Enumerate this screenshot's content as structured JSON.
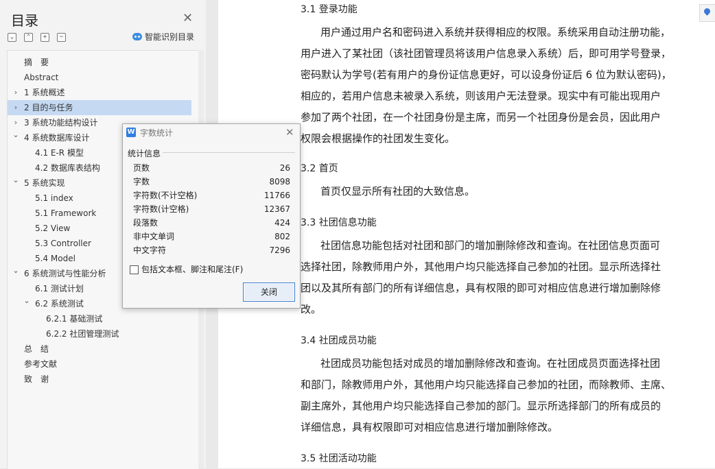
{
  "toc": {
    "title": "目录",
    "smart_label": "智能识别目录",
    "toolbar_icons": [
      "collapse-all-icon",
      "expand-all-icon",
      "plus-icon",
      "minus-icon"
    ],
    "items": [
      {
        "label": "摘　要",
        "level": 0,
        "chevron": ""
      },
      {
        "label": "Abstract",
        "level": 0,
        "chevron": ""
      },
      {
        "label": "1  系统概述",
        "level": 0,
        "chevron": "right"
      },
      {
        "label": "2  目的与任务",
        "level": 0,
        "chevron": "right",
        "selected": true
      },
      {
        "label": "3  系统功能结构设计",
        "level": 0,
        "chevron": "right"
      },
      {
        "label": "4  系统数据库设计",
        "level": 0,
        "chevron": "down"
      },
      {
        "label": "4.1 E-R 模型",
        "level": 1,
        "chevron": ""
      },
      {
        "label": "4.2  数据库表结构",
        "level": 1,
        "chevron": ""
      },
      {
        "label": "5  系统实现",
        "level": 0,
        "chevron": "down"
      },
      {
        "label": "5.1 index",
        "level": 1,
        "chevron": ""
      },
      {
        "label": "5.1 Framework",
        "level": 1,
        "chevron": ""
      },
      {
        "label": "5.2 View",
        "level": 1,
        "chevron": ""
      },
      {
        "label": "5.3 Controller",
        "level": 1,
        "chevron": ""
      },
      {
        "label": "5.4 Model",
        "level": 1,
        "chevron": ""
      },
      {
        "label": "6 系统测试与性能分析",
        "level": 0,
        "chevron": "down"
      },
      {
        "label": "6.1  测试计划",
        "level": 1,
        "chevron": ""
      },
      {
        "label": "6.2  系统测试",
        "level": 1,
        "chevron": "down"
      },
      {
        "label": "6.2.1 基础测试",
        "level": 2,
        "chevron": ""
      },
      {
        "label": "6.2.2  社团管理测试",
        "level": 2,
        "chevron": ""
      },
      {
        "label": "总　结",
        "level": 0,
        "chevron": ""
      },
      {
        "label": "参考文献",
        "level": 0,
        "chevron": ""
      },
      {
        "label": "致　谢",
        "level": 0,
        "chevron": ""
      }
    ]
  },
  "document": {
    "sections": [
      {
        "heading": "3.1  登录功能",
        "lines": [
          "用户通过用户名和密码进入系统并获得相应的权限。系统采用自动注册功能，",
          "用户进入了某社团（该社团管理员将该用户信息录入系统）后，即可用学号登录，",
          "密码默认为学号(若有用户的身份证信息更好，可以设身份证后 6 位为默认密码)，",
          "相应的，若用户信息未被录入系统，则该用户无法登录。现实中有可能出现用户",
          "参加了两个社团，在一个社团身份是主席，而另一个社团身份是会员，因此用户",
          "权限会根据操作的社团发生变化。"
        ]
      },
      {
        "heading": "3.2  首页",
        "lines": [
          "首页仅显示所有社团的大致信息。"
        ]
      },
      {
        "heading": "3.3  社团信息功能",
        "lines": [
          "社团信息功能包括对社团和部门的增加删除修改和查询。在社团信息页面可",
          "选择社团，除教师用户外，其他用户均只能选择自己参加的社团。显示所选择社",
          "团以及其所有部门的所有详细信息，具有权限的即可对相应信息进行增加删除修",
          "改。"
        ]
      },
      {
        "heading": "3.4  社团成员功能",
        "lines": [
          "社团成员功能包括对成员的增加删除修改和查询。在社团成员页面选择社团",
          "和部门，除教师用户外，其他用户均只能选择自己参加的社团，而除教师、主席、",
          "副主席外，其他用户均只能选择自己参加的部门。显示所选择部门的所有成员的",
          "详细信息，具有权限即可对相应信息进行增加删除修改。"
        ]
      },
      {
        "heading": "3.5  社团活动功能",
        "lines": []
      }
    ]
  },
  "dialog": {
    "title": "字数统计",
    "group_label": "统计信息",
    "stats": [
      {
        "label": "页数",
        "value": "26"
      },
      {
        "label": "字数",
        "value": "8098"
      },
      {
        "label": "字符数(不计空格)",
        "value": "11766"
      },
      {
        "label": "字符数(计空格)",
        "value": "12367"
      },
      {
        "label": "段落数",
        "value": "424"
      },
      {
        "label": "非中文单词",
        "value": "802"
      },
      {
        "label": "中文字符",
        "value": "7296"
      }
    ],
    "checkbox_label": "包括文本框、脚注和尾注(F)",
    "checkbox_checked": false,
    "close_button": "关闭"
  }
}
